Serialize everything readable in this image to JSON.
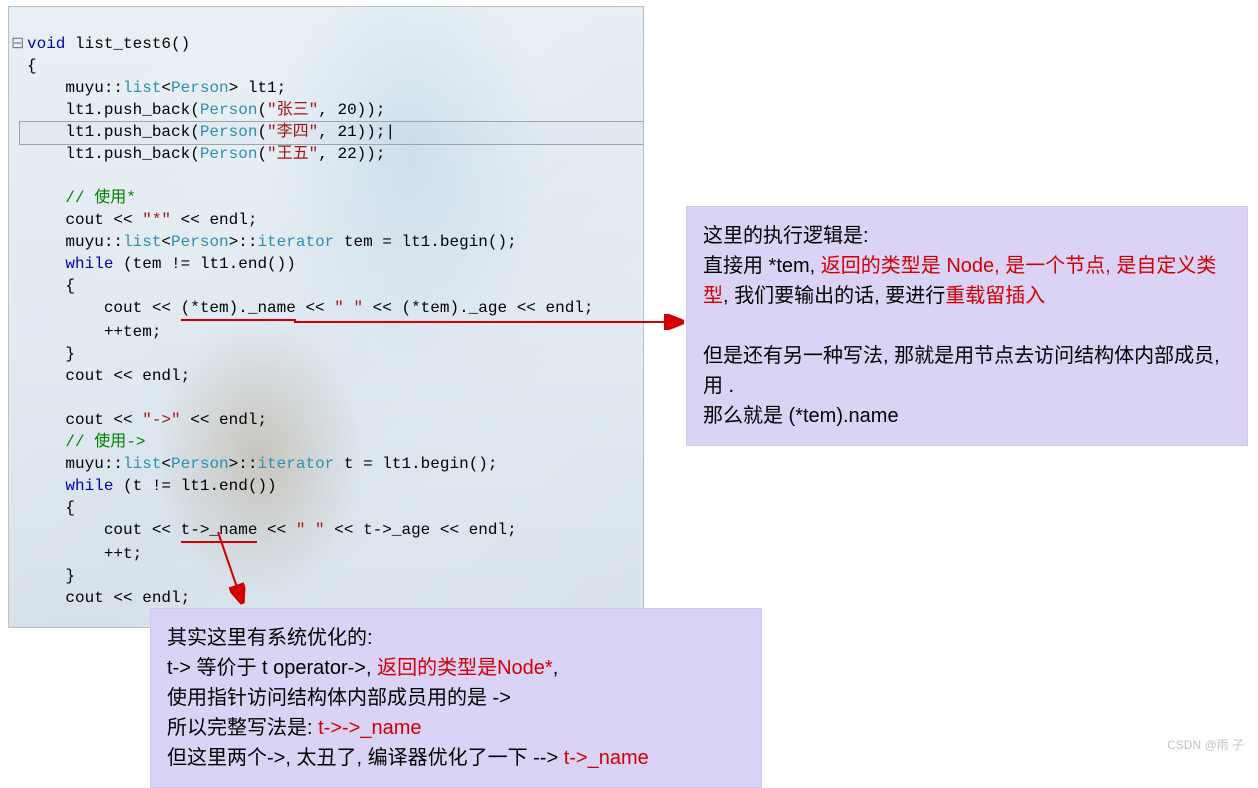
{
  "code": {
    "l1a": "void",
    "l1b": " list_test6()",
    "l2": "{",
    "l3a": "    muyu::",
    "l3b": "list",
    "l3c": "<",
    "l3d": "Person",
    "l3e": "> lt1;",
    "l4a": "    lt1.push_back(",
    "l4b": "Person",
    "l4c": "(",
    "l4s": "\"张三\"",
    "l4d": ", 20));",
    "l5a": "    lt1.push_back(",
    "l5b": "Person",
    "l5c": "(",
    "l5s": "\"李四\"",
    "l5d": ", 21));|",
    "l6a": "    lt1.push_back(",
    "l6b": "Person",
    "l6c": "(",
    "l6s": "\"王五\"",
    "l6d": ", 22));",
    "l7": "",
    "l8": "    // 使用*",
    "l9a": "    cout << ",
    "l9s": "\"*\"",
    "l9b": " << endl;",
    "l10a": "    muyu::",
    "l10b": "list",
    "l10c": "<",
    "l10d": "Person",
    "l10e": ">::",
    "l10f": "iterator",
    "l10g": " tem = lt1.begin();",
    "l11a": "    ",
    "l11b": "while",
    "l11c": " (tem != lt1.end())",
    "l12": "    {",
    "l13a": "        cout << ",
    "l13u": "(*tem)._name",
    "l13b": " << ",
    "l13s": "\" \"",
    "l13c": " << (*tem)._age << endl;",
    "l14": "        ++tem;",
    "l15": "    }",
    "l16": "    cout << endl;",
    "l17": "",
    "l18a": "    cout << ",
    "l18s": "\"->\"",
    "l18b": " << endl;",
    "l19": "    // 使用->",
    "l20a": "    muyu::",
    "l20b": "list",
    "l20c": "<",
    "l20d": "Person",
    "l20e": ">::",
    "l20f": "iterator",
    "l20g": " t = lt1.begin();",
    "l21a": "    ",
    "l21b": "while",
    "l21c": " (t != lt1.end())",
    "l22": "    {",
    "l23a": "        cout << ",
    "l23u": "t->_name",
    "l23b": " << ",
    "l23s": "\" \"",
    "l23c": " << t->_age << endl;",
    "l24": "        ++t;",
    "l25": "    }",
    "l26": "    cout << endl;",
    "l27": "",
    "l28": "}"
  },
  "annot_top": {
    "p1": "这里的执行逻辑是:",
    "p2a": "直接用 *tem, ",
    "p2b": "返回的类型是 Node, 是一个节点, 是自定义类型",
    "p2c": ", 我们要输出的话, 要进行",
    "p2d": "重载留插入",
    "p3": "",
    "p4": "但是还有另一种写法, 那就是用节点去访问结构体内部成员, 用 .",
    "p5": "那么就是 (*tem).name"
  },
  "annot_bottom": {
    "p1": "其实这里有系统优化的:",
    "p2a": "t-> 等价于 t operator->, ",
    "p2b": "返回的类型是Node*",
    "p2c": ",",
    "p3": "使用指针访问结构体内部成员用的是 ->",
    "p4a": "所以完整写法是: ",
    "p4b": "t->->_name",
    "p5a": "但这里两个->, 太丑了, 编译器优化了一下 --> ",
    "p5b": "t->_name"
  },
  "watermark": "CSDN @雨 子"
}
